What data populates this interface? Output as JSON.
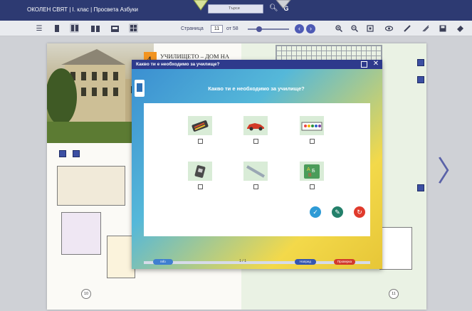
{
  "app": {
    "title": "ОКОЛЕН СВЯТ | I. клас | Просвета Азбуки",
    "search_placeholder": "Търси",
    "g_label": "G"
  },
  "toolbar": {
    "page_label": "Страница",
    "page_value": "11",
    "page_of": "от 58"
  },
  "book": {
    "chapter_number": "4.",
    "chapter_title": "УЧИЛИЩЕТО – ДОМ НА ЗНАНИЯ И ИГРИ",
    "left_page_number": "10",
    "right_page_number": "11"
  },
  "dialog": {
    "window_title": "Какво ти е необходимо за училище?",
    "heading": "Какво ти е необходимо за училище?",
    "counter": "1 / 1",
    "left_pill": "Info",
    "mid_pill": "Напред",
    "right_pill": "Проверка",
    "items": [
      {
        "name": "pencil-case"
      },
      {
        "name": "toy-car"
      },
      {
        "name": "watercolor-paints"
      },
      {
        "name": "sharpener"
      },
      {
        "name": "ruler"
      },
      {
        "name": "alphabet-cards"
      }
    ]
  },
  "colors": {
    "titlebar": "#2d3a72",
    "dialog_titlebar": "#2e3a8c",
    "check": "#2e9bd6",
    "hint": "#23806a",
    "retry": "#e03a2c",
    "chapter_badge": "#f29420"
  }
}
